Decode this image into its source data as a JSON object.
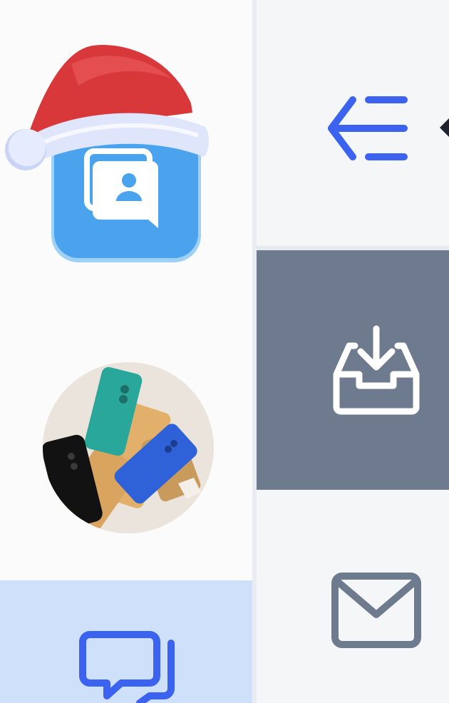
{
  "left_rail": {
    "logo_icon": "santa-hat-contacts-app-icon",
    "avatar_icon": "phones-photo-avatar",
    "chat_item_icon": "chat-bubbles-icon",
    "chat_item_selected": true
  },
  "right_panel": {
    "collapse_icon": "collapse-menu-arrow-icon",
    "inbox_icon": "inbox-download-icon",
    "inbox_selected": true,
    "mail_icon": "envelope-icon"
  },
  "colors": {
    "accent_blue": "#3b63f0",
    "selected_row_bg": "#6e7a8e",
    "chat_item_bg": "#cfe0fb",
    "icon_gray": "#6e7a8e",
    "logo_blue": "#4aa3ec",
    "hat_red": "#d9383b"
  }
}
